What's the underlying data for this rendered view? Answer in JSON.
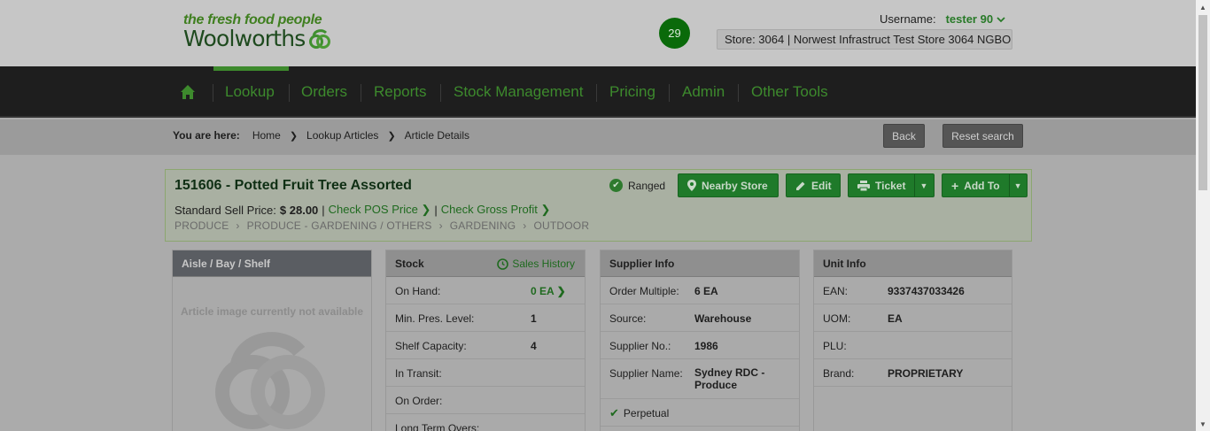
{
  "header": {
    "logo_tagline": "the fresh food people",
    "logo_name": "Woolworths",
    "notification_count": "29",
    "username_label": "Username:",
    "username": "tester 90",
    "store": "Store: 3064 | Norwest Infrastruct Test Store 3064 NGBO"
  },
  "nav": {
    "items": [
      {
        "label": "Lookup"
      },
      {
        "label": "Orders"
      },
      {
        "label": "Reports"
      },
      {
        "label": "Stock Management"
      },
      {
        "label": "Pricing"
      },
      {
        "label": "Admin"
      },
      {
        "label": "Other Tools"
      }
    ]
  },
  "breadcrumb": {
    "prefix": "You are here:",
    "items": [
      "Home",
      "Lookup Articles",
      "Article Details"
    ],
    "back_label": "Back",
    "reset_label": "Reset search"
  },
  "article": {
    "title": "151606 - Potted Fruit Tree Assorted",
    "price_label": "Standard Sell Price:",
    "price_value": "$ 28.00",
    "sep": "|",
    "check_pos": "Check POS Price",
    "check_gp": "Check Gross Profit",
    "path": [
      "PRODUCE",
      "PRODUCE - GARDENING / OTHERS",
      "GARDENING",
      "OUTDOOR"
    ],
    "ranged": "Ranged",
    "buttons": {
      "nearby": "Nearby Store",
      "edit": "Edit",
      "ticket": "Ticket",
      "add_to": "Add To"
    }
  },
  "aisle": {
    "title": "Aisle / Bay / Shelf",
    "no_image": "Article image currently not available"
  },
  "stock": {
    "title": "Stock",
    "sales_history": "Sales History",
    "rows": [
      {
        "k": "On Hand:",
        "v": "0 EA"
      },
      {
        "k": "Min. Pres. Level:",
        "v": "1"
      },
      {
        "k": "Shelf Capacity:",
        "v": "4"
      },
      {
        "k": "In Transit:",
        "v": ""
      },
      {
        "k": "On Order:",
        "v": ""
      },
      {
        "k": "Long Term Overs:",
        "v": ""
      }
    ]
  },
  "supplier": {
    "title": "Supplier Info",
    "rows": [
      {
        "k": "Order Multiple:",
        "v": "6 EA"
      },
      {
        "k": "Source:",
        "v": "Warehouse"
      },
      {
        "k": "Supplier No.:",
        "v": "1986"
      },
      {
        "k": "Supplier Name:",
        "v": "Sydney RDC - Produce"
      }
    ],
    "perpetual": "Perpetual"
  },
  "unit": {
    "title": "Unit Info",
    "rows": [
      {
        "k": "EAN:",
        "v": "9337437033426"
      },
      {
        "k": "UOM:",
        "v": "EA"
      },
      {
        "k": "PLU:",
        "v": ""
      },
      {
        "k": "Brand:",
        "v": "PROPRIETARY"
      }
    ]
  }
}
